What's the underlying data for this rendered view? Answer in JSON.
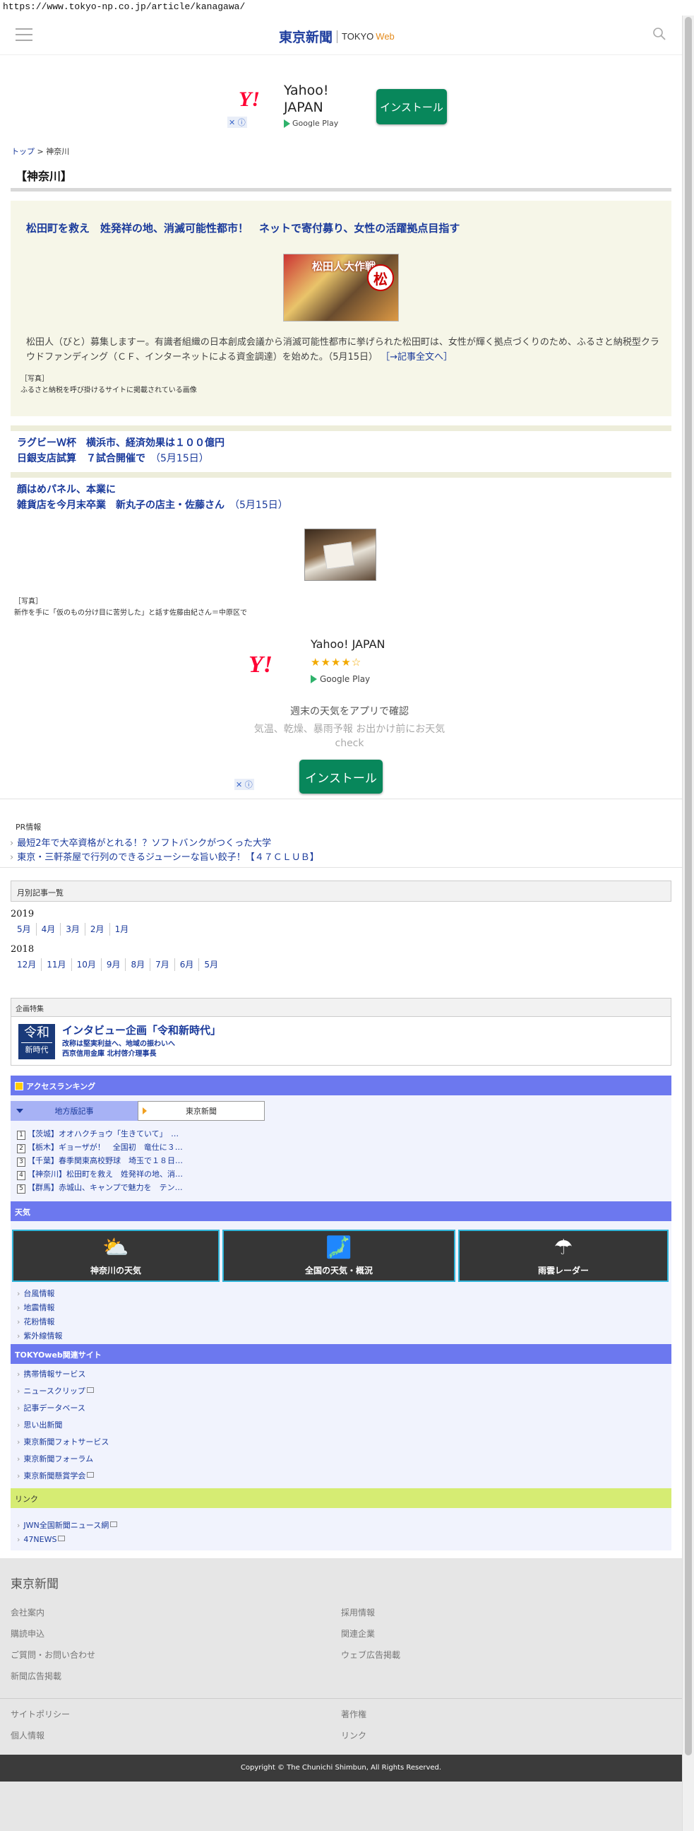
{
  "browser": {
    "url": "https://www.tokyo-np.co.jp/article/kanagawa/"
  },
  "header": {
    "logo_jp": "東京新聞",
    "logo_tokyo": "TOKYO",
    "logo_web": "Web"
  },
  "ad_top": {
    "name": "Yahoo! JAPAN",
    "store": "Google Play",
    "install": "インストール"
  },
  "breadcrumb": {
    "home": "トップ",
    "sep": ">",
    "current": "神奈川"
  },
  "section_title": "【神奈川】",
  "feature": {
    "headline": "松田町を救え　姓発祥の地、消滅可能性都市！　ネットで寄付募り、女性の活躍拠点目指す",
    "image_text": "松田人大作戦",
    "image_seal": "松",
    "body": "松田人（びと）募集しますー。有識者組織の日本創成会議から消滅可能性都市に挙げられた松田町は、女性が輝く拠点づくりのため、ふるさと納税型クラウドファンディング（ＣＦ、インターネットによる資金調達）を始めた。（5月15日）",
    "more": "［→記事全文へ］",
    "caption_label": "［写真］",
    "caption": "ふるさと納税を呼び掛けるサイトに掲載されている画像"
  },
  "news": [
    {
      "line1": "ラグビーＷ杯　横浜市、経済効果は１００億円",
      "line2": "日銀支店試算　７試合開催で",
      "date": "（5月15日）"
    },
    {
      "line1": "顔はめパネル、本業に",
      "line2": "雑貨店を今月末卒業　新丸子の店主・佐藤さん",
      "date": "（5月15日）"
    }
  ],
  "news_caption": {
    "label": "［写真］",
    "text": "新作を手に「仮のもの分け目に苦労した」と話す佐藤由紀さん＝中原区で"
  },
  "ad_mid": {
    "name": "Yahoo! JAPAN",
    "stars": "★★★★☆",
    "store": "Google Play",
    "line1": "週末の天気をアプリで確認",
    "line2": "気温、乾燥、暴雨予報 お出かけ前にお天気check",
    "install": "インストール"
  },
  "pr": {
    "label": "PR情報",
    "items": [
      "最短2年で大卒資格がとれる！？ソフトバンクがつくった大学",
      "東京・三軒茶屋で行列のできるジューシーな旨い餃子！【４７ＣＬＵＢ】"
    ]
  },
  "monthly": {
    "title": "月別記事一覧",
    "years": [
      {
        "year": "2019",
        "months": [
          "5月",
          "4月",
          "3月",
          "2月",
          "1月"
        ]
      },
      {
        "year": "2018",
        "months": [
          "12月",
          "11月",
          "10月",
          "9月",
          "8月",
          "7月",
          "6月",
          "5月"
        ]
      }
    ]
  },
  "kikaku": {
    "head": "企画特集",
    "badge1": "令和",
    "badge2": "新時代",
    "title": "インタビュー企画「令和新時代」",
    "sub1": "改称は堅実利益へ、地域の振わいへ",
    "sub2": "西京信用金庫 北村啓介理事長"
  },
  "ranking": {
    "title": "アクセスランキング",
    "tab_local": "地方版記事",
    "tab_tokyo": "東京新聞",
    "items": [
      {
        "n": "1",
        "text": "【茨城】オオハクチョウ「生きていて」　…"
      },
      {
        "n": "2",
        "text": "【栃木】ギョーザが！　全国初　竜仕に３…"
      },
      {
        "n": "3",
        "text": "【千葉】春季関東高校野球　埼玉で１８日…"
      },
      {
        "n": "4",
        "text": "【神奈川】松田町を救え　姓発祥の地、消…"
      },
      {
        "n": "5",
        "text": "【群馬】赤城山、キャンプで魅力を　テン…"
      }
    ]
  },
  "weather": {
    "title": "天気",
    "tiles": [
      "神奈川の天気",
      "全国の天気・概況",
      "雨雲レーダー"
    ],
    "links": [
      "台風情報",
      "地震情報",
      "花粉情報",
      "紫外線情報"
    ]
  },
  "related": {
    "title": "TOKYOweb関連サイト",
    "links": [
      "携帯情報サービス",
      "ニュースクリップ",
      "記事データベース",
      "思い出新聞",
      "東京新聞フォトサービス",
      "東京新聞フォーラム",
      "東京新聞懸賞学会"
    ]
  },
  "links_box": {
    "title": "リンク",
    "links": [
      "JWN全国新聞ニュース網",
      "47NEWS"
    ]
  },
  "footer": {
    "logo": "東京新聞",
    "left": [
      "会社案内",
      "購読申込",
      "ご質問・お問い合わせ",
      "新聞広告掲載"
    ],
    "right": [
      "採用情報",
      "関連企業",
      "ウェブ広告掲載"
    ],
    "bottom_left": [
      "サイトポリシー",
      "個人情報"
    ],
    "bottom_right": [
      "著作権",
      "リンク"
    ],
    "copyright": "Copyright © The Chunichi Shimbun, All Rights Reserved."
  },
  "colors": {
    "brand": "#1d3c9d",
    "install": "#08875b",
    "bar": "#6c78ef",
    "link_bar": "#d6ec73"
  }
}
